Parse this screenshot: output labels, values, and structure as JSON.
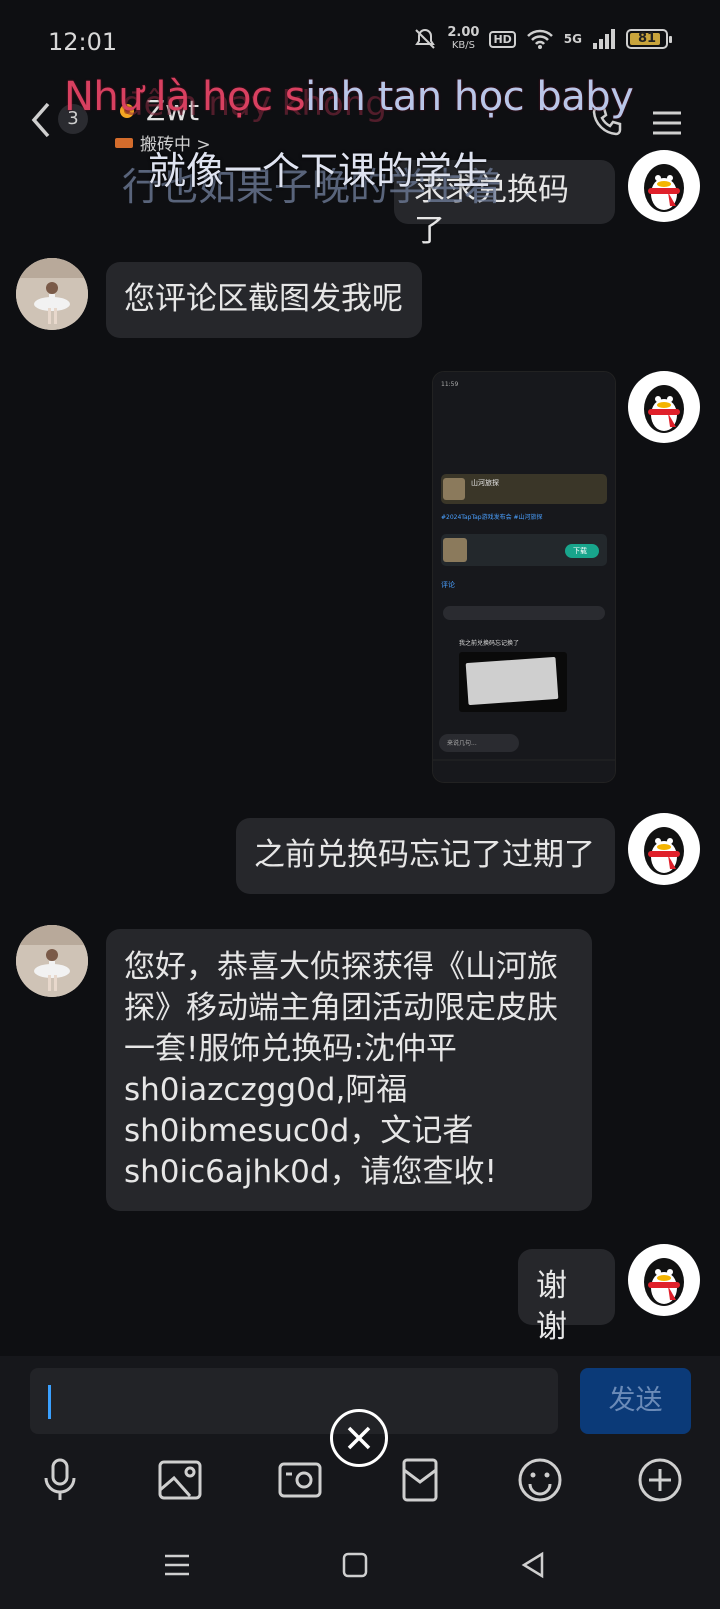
{
  "status": {
    "time": "12:01",
    "speed_value": "2.00",
    "speed_unit": "KB/S",
    "hd": "HD",
    "network": "5G",
    "battery": "81"
  },
  "header": {
    "unread_count": "3",
    "contact_name": "Zwt",
    "contact_status": "搬砖中 >"
  },
  "subtitles": {
    "line1_red": "Như là học s",
    "line1_blue": "inh tan học baby",
    "line2": "就像一个下课的学生",
    "line3_ghost": "行也如果子晚的学生着",
    "line4_ghost": "đêm nay không"
  },
  "messages": [
    {
      "side": "right",
      "type": "text",
      "text": "求求兑换码了"
    },
    {
      "side": "left",
      "type": "text",
      "text": "您评论区截图发我呢"
    },
    {
      "side": "right",
      "type": "image"
    },
    {
      "side": "right",
      "type": "text",
      "text": "之前兑换码忘记了过期了"
    },
    {
      "side": "left",
      "type": "text",
      "lines": [
        "您好，恭喜大侦探获得《山河旅",
        "探》移动端主角团活动限定皮肤",
        "一套!服饰兑换码:沈仲平",
        "sh0iazczgg0d,阿福",
        "sh0ibmesuc0d，文记者",
        "sh0ic6ajhk0d，请您查收!"
      ]
    },
    {
      "side": "right",
      "type": "text",
      "text": "谢谢"
    }
  ],
  "screenshot": {
    "title": "山河旅探",
    "hashtag": "#2024TapTap游戏发布会 #山河旅探",
    "download": "下载",
    "tab": "评论",
    "comment": "我之前兑换码忘记换了",
    "input_placeholder": "来说几句..."
  },
  "input": {
    "placeholder": "",
    "send_label": "发送"
  },
  "colors": {
    "background": "#0e0f12",
    "bubble": "#26272b",
    "send_button": "#0b3a78",
    "caret": "#3aa0ff"
  }
}
